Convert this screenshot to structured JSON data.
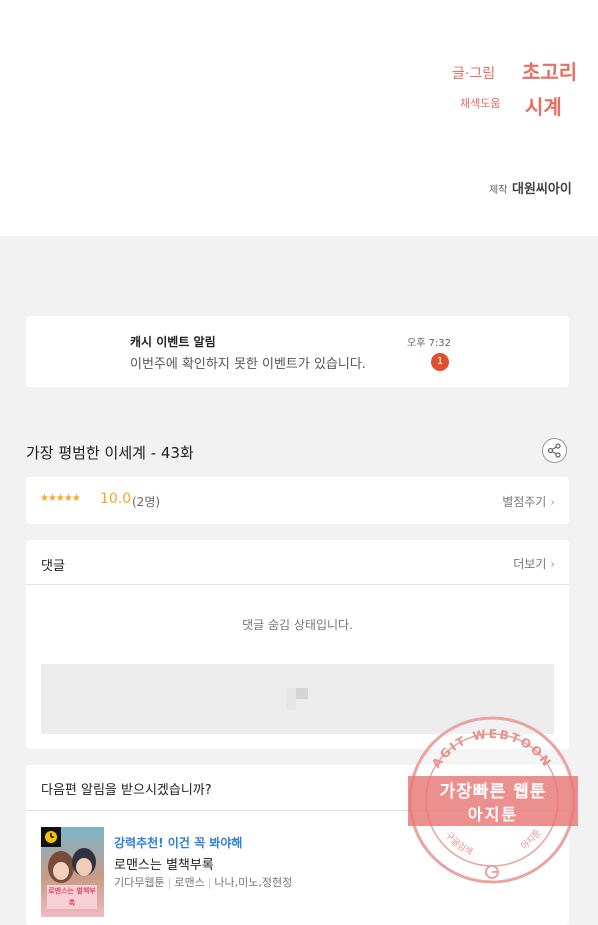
{
  "credits": {
    "writer_label": "글·그림",
    "writer_name": "초고리",
    "color_label": "채색도움",
    "color_name": "시계",
    "production_label": "제작",
    "production_name": "대원씨아이"
  },
  "notification": {
    "title": "캐시 이벤트 알림",
    "message": "이번주에 확인하지 못한 이벤트가 있습니다.",
    "time": "오후 7:32",
    "badge_count": "1"
  },
  "episode": {
    "title": "가장 평범한 이세계 - 43화",
    "share_icon": "share-icon"
  },
  "rating": {
    "stars": "★★★★★",
    "score": "10.0",
    "votes": "(2명)",
    "rate_button": "별점주기",
    "star_color": "#f5a623"
  },
  "comments": {
    "title": "댓글",
    "more": "더보기",
    "hidden_message": "댓글 숨김 상태입니다."
  },
  "next_episode_alert": {
    "question": "다음편 알림을 받으시겠습니까?"
  },
  "recommendation": {
    "label": "강력추천! 이건 꼭 봐야해",
    "title": "로맨스는 별책부록",
    "platform": "기다무웹툰",
    "genre": "로맨스",
    "authors": "나나,미노,정현정",
    "thumbnail_text": "로맨스는 별책부록",
    "label_color": "#2f7fd8"
  },
  "watermark": {
    "arc_text": "AGIT WEBTOON",
    "line1": "가장빠른 웹툰",
    "line2": "아지툰",
    "bottom_left": "구글검색",
    "bottom_right": "아지툰"
  },
  "colors": {
    "credit_accent": "#e46f62",
    "badge": "#e0502e",
    "background": "#f2f2f2"
  }
}
